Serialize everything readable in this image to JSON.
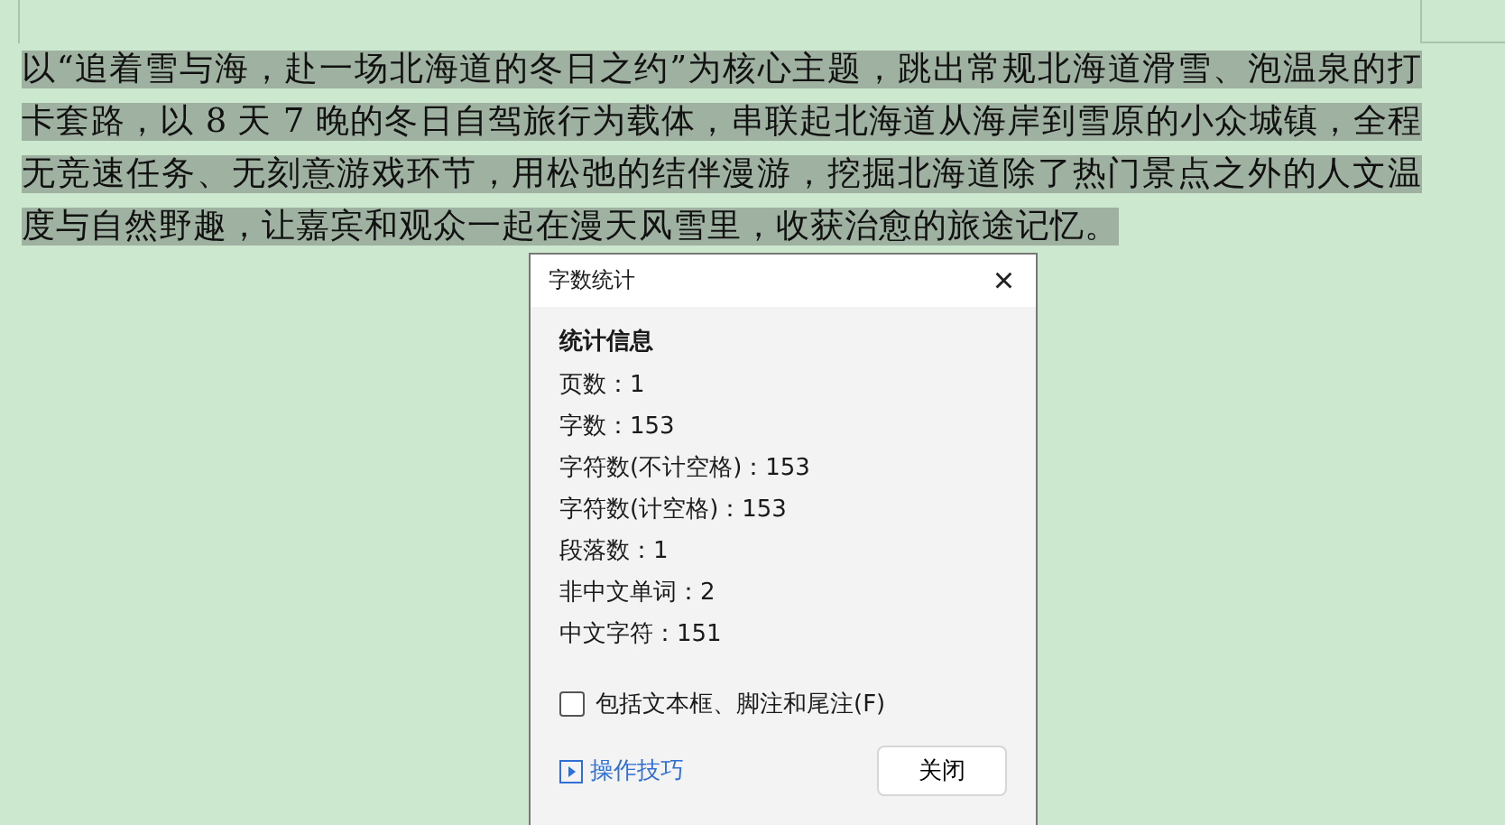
{
  "document": {
    "paragraph": "以“追着雪与海，赴一场北海道的冬日之约”为核心主题，跳出常规北海道滑雪、泡温泉的打卡套路，以 8 天 7 晚的冬日自驾旅行为载体，串联起北海道从海岸到雪原的小众城镇，全程无竞速任务、无刻意游戏环节，用松弛的结伴漫游，挖掘北海道除了热门景点之外的人文温度与自然野趣，让嘉宾和观众一起在漫天风雪里，收获治愈的旅途记忆。",
    "selected": true
  },
  "dialog": {
    "title": "字数统计",
    "close": "×",
    "heading": "统计信息",
    "stats": [
      "页数：1",
      "字数：153",
      "字符数(不计空格)：153",
      "字符数(计空格)：153",
      "段落数：1",
      "非中文单词：2",
      "中文字符：151"
    ],
    "checkbox": {
      "label": "包括文本框、脚注和尾注(F)",
      "checked": false
    },
    "tips_link": "操作技巧",
    "close_button": "关闭"
  }
}
